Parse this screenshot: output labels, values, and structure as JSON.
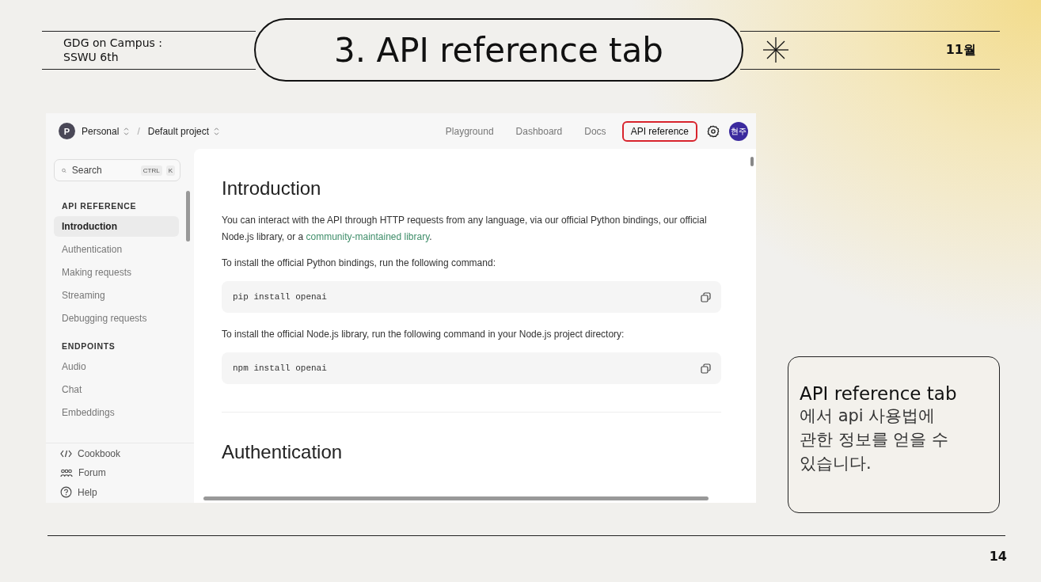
{
  "slide": {
    "org_lines": [
      "GDG on Campus :",
      "SSWU 6th"
    ],
    "title": "3. API reference tab",
    "month": "11월",
    "page_number": "14"
  },
  "screenshot": {
    "topbar": {
      "org": {
        "initial": "P",
        "name": "Personal"
      },
      "separator": "/",
      "project": "Default project",
      "nav": [
        {
          "label": "Playground",
          "selected": false
        },
        {
          "label": "Dashboard",
          "selected": false
        },
        {
          "label": "Docs",
          "selected": false
        },
        {
          "label": "API reference",
          "selected": true
        }
      ],
      "avatar": "현주"
    },
    "sidebar": {
      "search": {
        "placeholder": "Search",
        "keys": [
          "CTRL",
          "K"
        ]
      },
      "sections": [
        {
          "title": "API REFERENCE",
          "items": [
            {
              "label": "Introduction",
              "selected": true
            },
            {
              "label": "Authentication",
              "selected": false
            },
            {
              "label": "Making requests",
              "selected": false
            },
            {
              "label": "Streaming",
              "selected": false
            },
            {
              "label": "Debugging requests",
              "selected": false
            }
          ]
        },
        {
          "title": "ENDPOINTS",
          "items": [
            {
              "label": "Audio",
              "selected": false
            },
            {
              "label": "Chat",
              "selected": false
            },
            {
              "label": "Embeddings",
              "selected": false
            }
          ]
        }
      ],
      "footer": [
        {
          "label": "Cookbook",
          "kind": "code"
        },
        {
          "label": "Forum",
          "kind": "people"
        },
        {
          "label": "Help",
          "kind": "help"
        }
      ]
    },
    "content": {
      "blocks": [
        {
          "kind": "heading",
          "text": "Introduction"
        },
        {
          "kind": "paragraph",
          "text": "You can interact with the API through HTTP requests from any language, via our official Python bindings, our official Node.js library, or a ",
          "link": "community-maintained library",
          "after": "."
        },
        {
          "kind": "paragraph",
          "text": "To install the official Python bindings, run the following command:"
        },
        {
          "kind": "code",
          "text": "pip install openai"
        },
        {
          "kind": "paragraph",
          "text": "To install the official Node.js library, run the following command in your Node.js project directory:"
        },
        {
          "kind": "code",
          "text": "npm install openai"
        },
        {
          "kind": "divider"
        },
        {
          "kind": "heading",
          "text": "Authentication"
        }
      ]
    }
  },
  "note": {
    "title": "API reference tab",
    "body": "에서 api 사용법에 관한 정보를 얻을 수 있습니다."
  }
}
